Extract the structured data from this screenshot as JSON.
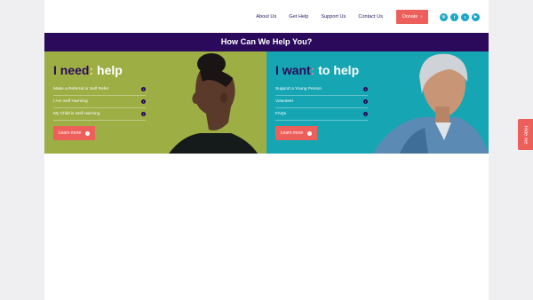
{
  "nav": {
    "links": [
      "About Us",
      "Get Help",
      "Support Us",
      "Contact Us"
    ],
    "donate_label": "Donate",
    "social_icons": [
      "instagram-icon",
      "facebook-icon",
      "twitter-icon",
      "youtube-icon"
    ]
  },
  "banner": {
    "title": "How Can We Help You?"
  },
  "need_panel": {
    "title_first": "I need",
    "title_colon": ":",
    "title_last": "help",
    "links": [
      "Make a Referral or Self Refer",
      "I Am Self Harming",
      "My Child is Self Harming"
    ],
    "button_label": "Learn more"
  },
  "want_panel": {
    "title_first": "I want",
    "title_colon": ":",
    "title_last": "to help",
    "links": [
      "Support a Young Person",
      "Volunteer",
      "FAQs"
    ],
    "button_label": "Learn more"
  },
  "side_tab": {
    "label": "Hide me"
  },
  "colors": {
    "purple": "#2b0a5c",
    "green": "#9dae45",
    "teal": "#16a6b3",
    "coral": "#ec5f5b"
  }
}
